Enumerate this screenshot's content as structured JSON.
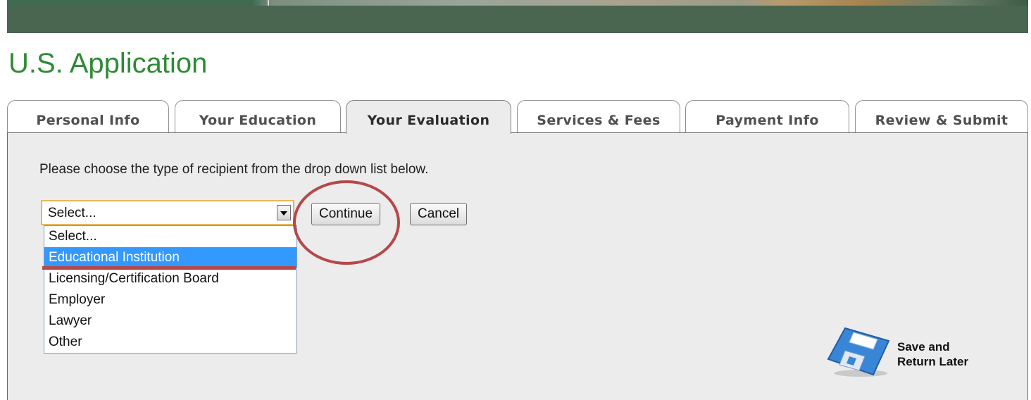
{
  "page": {
    "title": "U.S. Application"
  },
  "tabs": [
    {
      "label": "Personal Info"
    },
    {
      "label": "Your Education"
    },
    {
      "label": "Your Evaluation",
      "active": true
    },
    {
      "label": "Services & Fees"
    },
    {
      "label": "Payment Info"
    },
    {
      "label": "Review & Submit"
    }
  ],
  "form": {
    "instructions": "Please choose the type of recipient from the drop down list below.",
    "recipient_select": {
      "value": "Select...",
      "options": [
        "Select...",
        "Educational Institution",
        "Licensing/Certification Board",
        "Employer",
        "Lawyer",
        "Other"
      ],
      "highlighted": "Educational Institution"
    },
    "continue_label": "Continue",
    "cancel_label": "Cancel"
  },
  "save_later": {
    "line1": "Save and",
    "line2": "Return Later",
    "icon": "floppy-disk-icon"
  },
  "colors": {
    "banner": "#4a6550",
    "title": "#2f8a36",
    "panel": "#ececec",
    "highlight": "#3399ff",
    "annotation": "#b5484a",
    "select_border": "#e6b85a"
  }
}
